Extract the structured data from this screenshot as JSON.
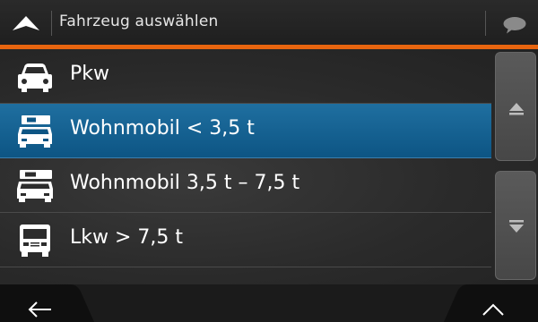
{
  "header": {
    "title": "Fahrzeug auswählen",
    "nav_icon": "navigation-arrow-icon",
    "message_icon": "speech-bubble-icon"
  },
  "accent_color": "#e8650f",
  "selection_color": "#0d5584",
  "vehicles": [
    {
      "label": "Pkw",
      "icon": "car-icon",
      "selected": false
    },
    {
      "label": "Wohnmobil < 3,5 t",
      "icon": "camper-small-icon",
      "selected": true
    },
    {
      "label": "Wohnmobil 3,5 t – 7,5 t",
      "icon": "camper-large-icon",
      "selected": false
    },
    {
      "label": "Lkw > 7,5 t",
      "icon": "truck-icon",
      "selected": false
    }
  ],
  "scroll": {
    "up_icon": "scroll-up-icon",
    "down_icon": "scroll-down-icon"
  },
  "footer": {
    "back_icon": "back-arrow-icon",
    "expand_icon": "chevron-up-icon"
  }
}
